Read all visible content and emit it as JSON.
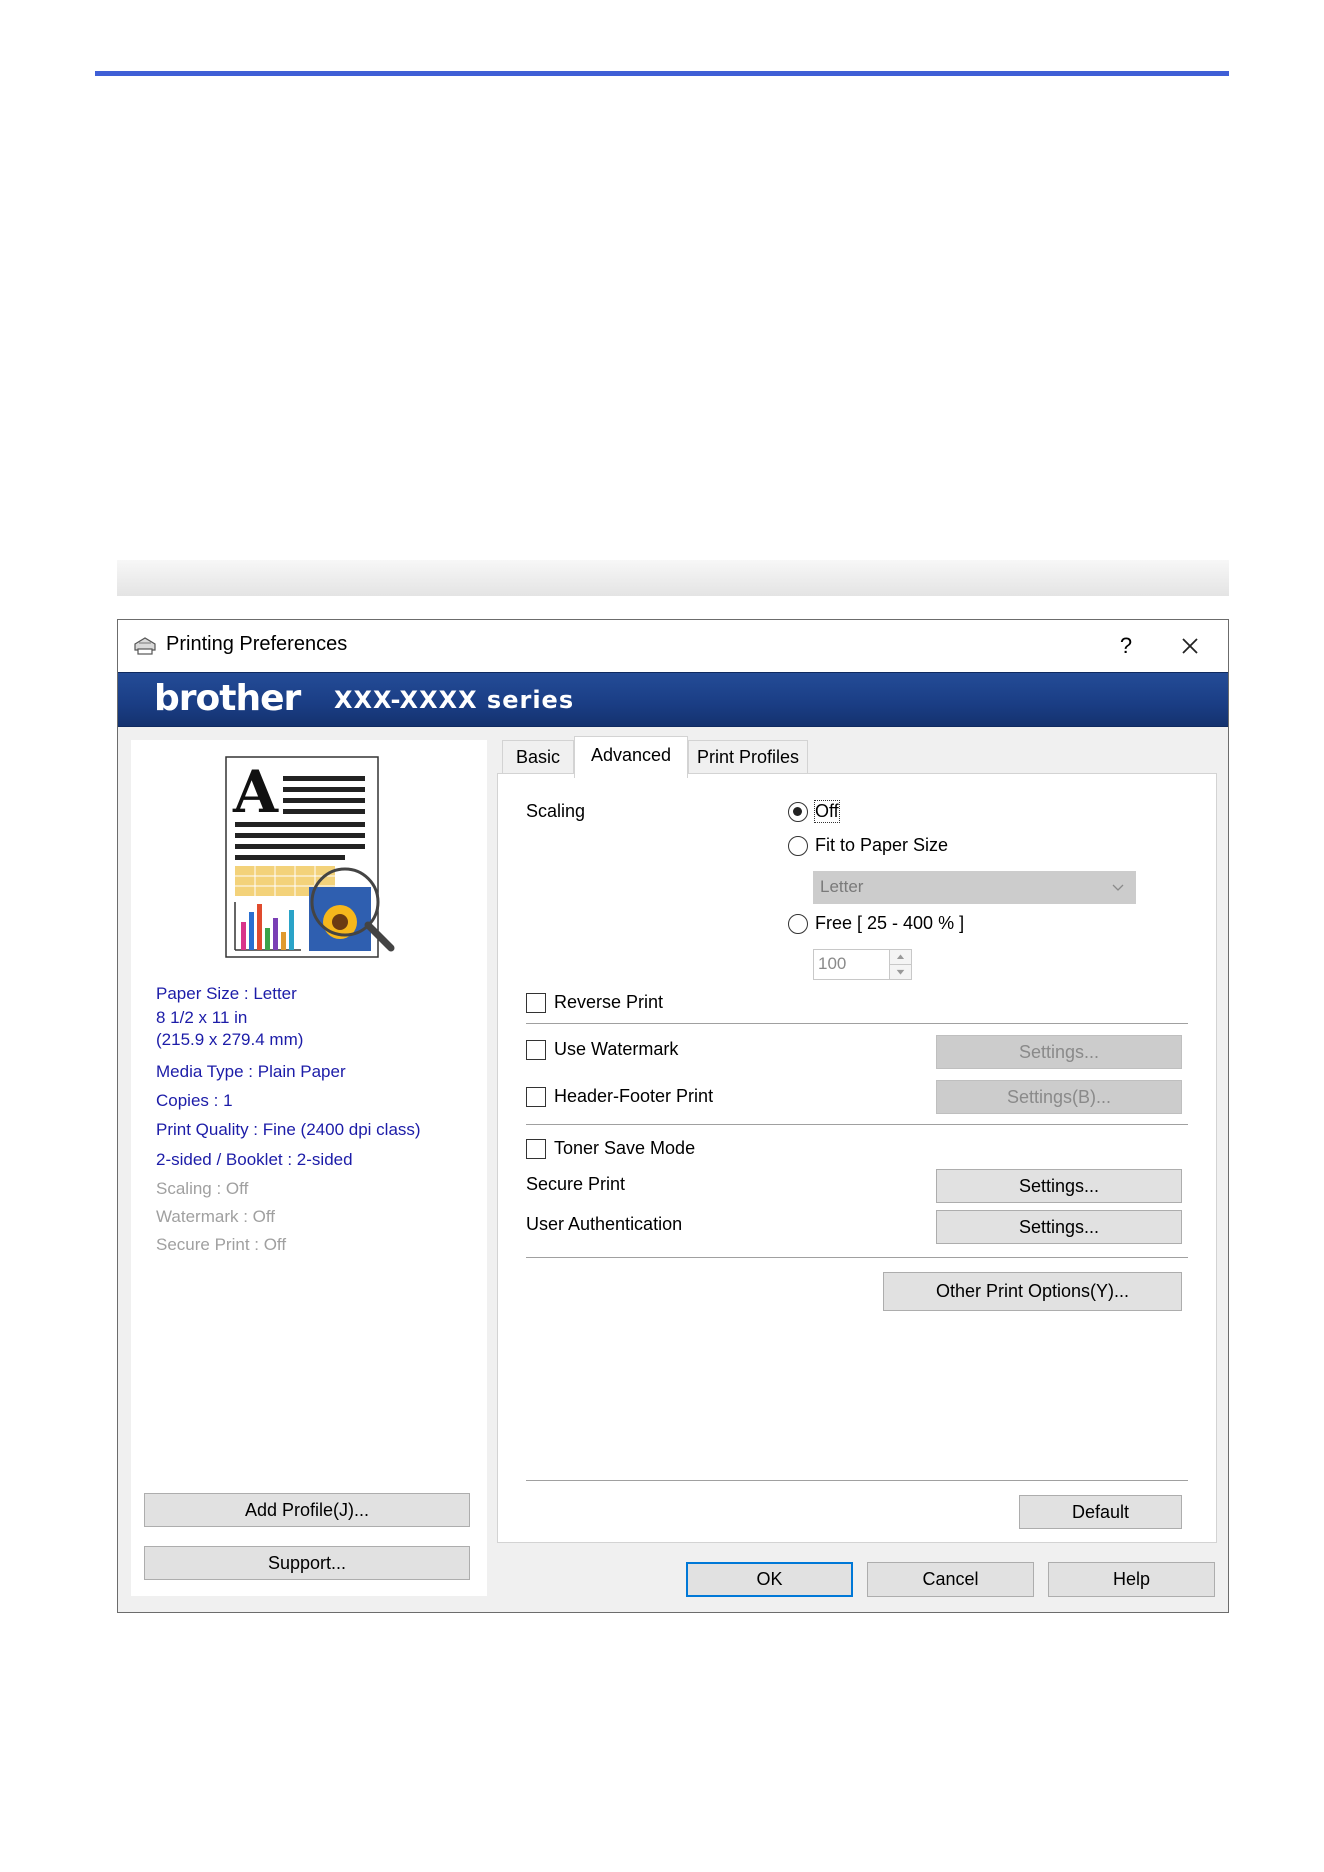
{
  "dialog": {
    "title": "Printing Preferences",
    "help_glyph": "?",
    "brand": "brother",
    "model": "XXX-XXXX series"
  },
  "tabs": [
    {
      "label": "Basic",
      "active": false
    },
    {
      "label": "Advanced",
      "active": true
    },
    {
      "label": "Print Profiles",
      "active": false
    }
  ],
  "summary": {
    "paper_size": "Paper Size : Letter",
    "paper_dims": "8 1/2 x 11 in",
    "paper_mm": "(215.9 x 279.4 mm)",
    "media_type": "Media Type : Plain Paper",
    "copies": "Copies : 1",
    "print_quality": "Print Quality : Fine (2400 dpi class)",
    "two_sided": "2-sided / Booklet : 2-sided",
    "scaling": "Scaling : Off",
    "watermark": "Watermark : Off",
    "secure_print": "Secure Print : Off"
  },
  "left_buttons": {
    "add_profile": "Add Profile(J)...",
    "support": "Support..."
  },
  "advanced": {
    "scaling_label": "Scaling",
    "scaling_options": {
      "off": "Off",
      "fit": "Fit to Paper Size",
      "free": "Free [ 25 - 400 % ]"
    },
    "scaling_selected": "Off",
    "paper_size_select": "Letter",
    "free_value": "100",
    "reverse_print": "Reverse Print",
    "use_watermark": "Use Watermark",
    "watermark_settings": "Settings...",
    "header_footer": "Header-Footer Print",
    "header_footer_settings": "Settings(B)...",
    "toner_save": "Toner Save Mode",
    "secure_print": "Secure Print",
    "secure_settings": "Settings...",
    "user_auth": "User Authentication",
    "user_auth_settings": "Settings...",
    "other_options": "Other Print Options(Y)...",
    "default": "Default"
  },
  "footer_buttons": {
    "ok": "OK",
    "cancel": "Cancel",
    "help": "Help"
  },
  "colors": {
    "banner": "#1a3d84",
    "summary_text": "#1c1ca8",
    "accent_rule": "#3f5fd6"
  }
}
